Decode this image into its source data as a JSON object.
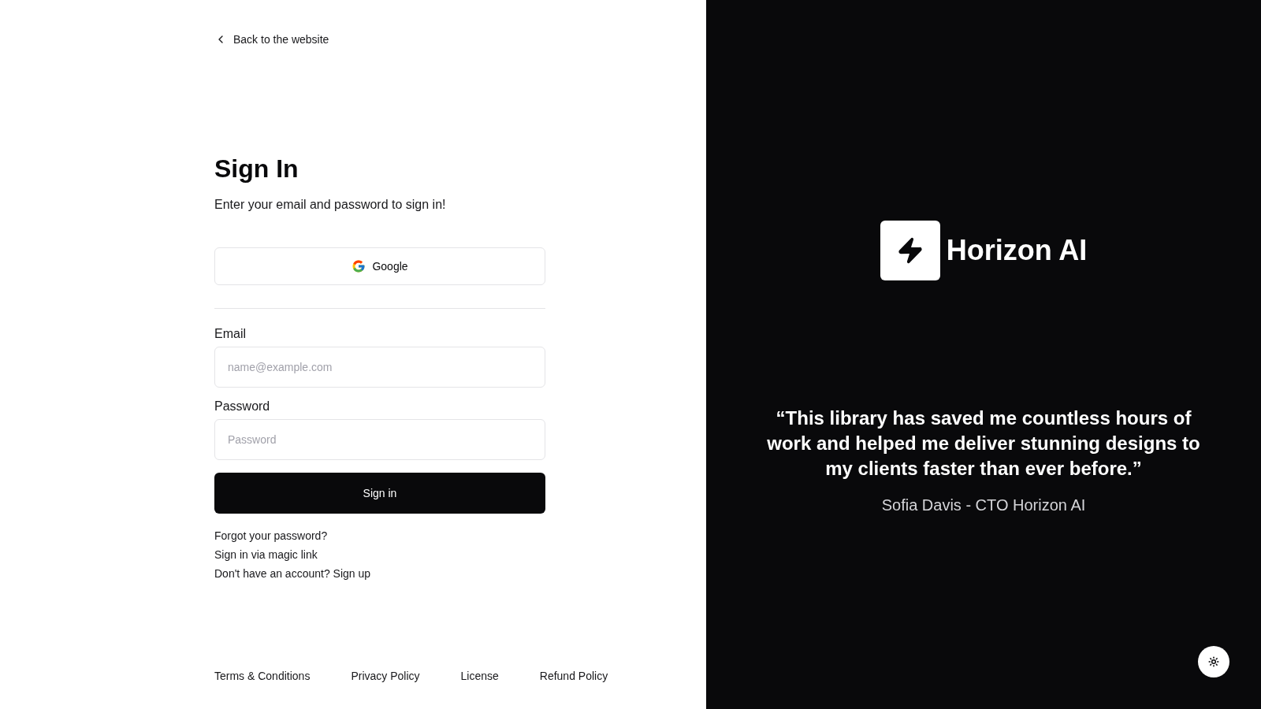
{
  "back_link": {
    "label": "Back to the website"
  },
  "heading": "Sign In",
  "subheading": "Enter your email and password to sign in!",
  "oauth_button": {
    "label": "Google"
  },
  "fields": [
    {
      "label": "Email",
      "placeholder": "name@example.com"
    },
    {
      "label": "Password",
      "placeholder": "Password"
    }
  ],
  "submit_button": {
    "label": "Sign in"
  },
  "links": [
    "Forgot your password?",
    "Sign in via magic link",
    "Don't have an account? Sign up"
  ],
  "footer_links": [
    "Terms & Conditions",
    "Privacy Policy",
    "License",
    "Refund Policy"
  ],
  "brand": {
    "name": "Horizon AI"
  },
  "testimonial": {
    "quote": "“This library has saved me countless hours of work and helped me deliver stunning designs to my clients faster than ever before.”",
    "author": "Sofia Davis - CTO Horizon AI"
  }
}
